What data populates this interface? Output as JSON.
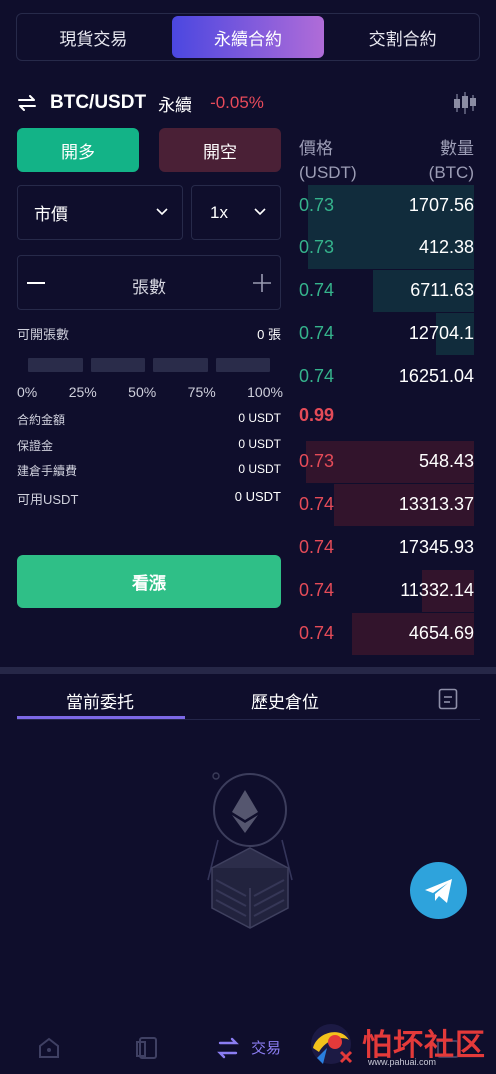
{
  "top_tabs": [
    {
      "label": "現貨交易",
      "active": false
    },
    {
      "label": "永續合約",
      "active": true
    },
    {
      "label": "交割合約",
      "active": false
    }
  ],
  "pair": {
    "name": "BTC/USDT",
    "type": "永續",
    "change": "-0.05%"
  },
  "actions": {
    "long": "開多",
    "short": "開空"
  },
  "order_type": "市價",
  "leverage": "1x",
  "quantity": {
    "placeholder": "張數"
  },
  "info": {
    "openable_label": "可開張數",
    "openable_value": "0 張",
    "contract_amount_label": "合約金額",
    "contract_amount_value": "0 USDT",
    "margin_label": "保證金",
    "margin_value": "0 USDT",
    "fee_label": "建倉手續費",
    "fee_value": "0 USDT",
    "available_label": "可用USDT",
    "available_value": "0 USDT"
  },
  "percent_marks": [
    "0%",
    "25%",
    "50%",
    "75%",
    "100%"
  ],
  "submit_label": "看漲",
  "orderbook": {
    "price_header": "價格",
    "price_unit": "(USDT)",
    "qty_header": "數量",
    "qty_unit": "(BTC)",
    "bids": [
      {
        "price": "0.73",
        "qty": "1707.56",
        "depth": 0.95
      },
      {
        "price": "0.73",
        "qty": "412.38",
        "depth": 0.95
      },
      {
        "price": "0.74",
        "qty": "6711.63",
        "depth": 0.58
      },
      {
        "price": "0.74",
        "qty": "12704.1",
        "depth": 0.22
      },
      {
        "price": "0.74",
        "qty": "16251.04",
        "depth": 0.0
      }
    ],
    "mid_price": "0.99",
    "asks": [
      {
        "price": "0.73",
        "qty": "548.43",
        "depth": 0.96
      },
      {
        "price": "0.74",
        "qty": "13313.37",
        "depth": 0.8
      },
      {
        "price": "0.74",
        "qty": "17345.93",
        "depth": 0.0
      },
      {
        "price": "0.74",
        "qty": "11332.14",
        "depth": 0.3
      },
      {
        "price": "0.74",
        "qty": "4654.69",
        "depth": 0.7
      }
    ]
  },
  "bottom_tabs": {
    "current": "當前委托",
    "history": "歷史倉位"
  },
  "bottom_nav": {
    "trade_label": "交易"
  },
  "watermark": {
    "text": "怕坏社区",
    "url": "www.pahuai.com"
  },
  "colors": {
    "green": "#35b38c",
    "red": "#e44b58",
    "accent": "#7c68e6"
  }
}
